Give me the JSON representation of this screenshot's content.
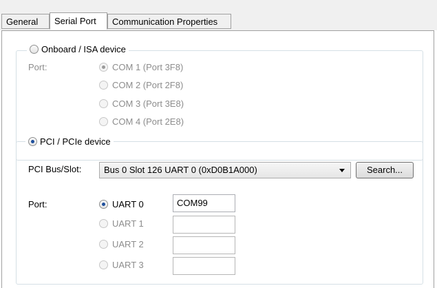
{
  "tabs": [
    {
      "label": "General",
      "active": false
    },
    {
      "label": "Serial Port",
      "active": true
    },
    {
      "label": "Communication Properties",
      "active": false
    }
  ],
  "onboard_group": {
    "legend": "Onboard / ISA device",
    "selected": false,
    "port_label": "Port:",
    "ports": [
      "COM 1 (Port 3F8)",
      "COM 2 (Port 2F8)",
      "COM 3 (Port 3E8)",
      "COM 4 (Port 2E8)"
    ],
    "selected_port": "COM 1 (Port 3F8)"
  },
  "pci_group": {
    "legend": "PCI / PCIe device",
    "selected": true,
    "bus_slot_label": "PCI Bus/Slot:",
    "bus_slot_value": "Bus 0 Slot 126 UART 0 (0xD0B1A000)",
    "search_label": "Search...",
    "port_label": "Port:",
    "uarts": [
      {
        "label": "UART 0",
        "value": "COM99",
        "selected": true,
        "enabled": true
      },
      {
        "label": "UART 1",
        "value": "",
        "selected": false,
        "enabled": false
      },
      {
        "label": "UART 2",
        "value": "",
        "selected": false,
        "enabled": false
      },
      {
        "label": "UART 3",
        "value": "",
        "selected": false,
        "enabled": false
      }
    ]
  }
}
